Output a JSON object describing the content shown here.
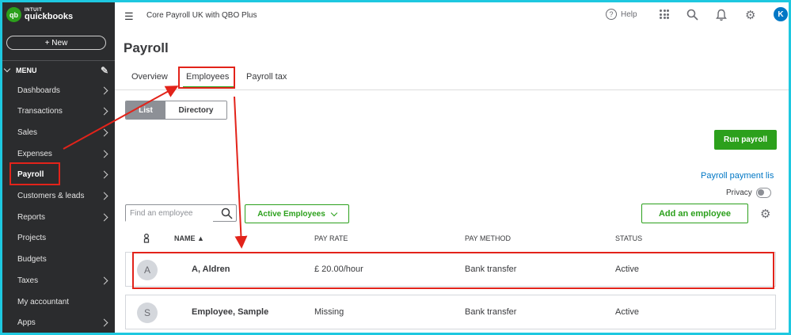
{
  "logo": {
    "brand_small": "INTUIT",
    "brand_name": "quickbooks",
    "mark": "qb"
  },
  "sidebar": {
    "new_label": "+ New",
    "menu_label": "MENU",
    "items": [
      {
        "label": "Dashboards",
        "has_arrow": true
      },
      {
        "label": "Transactions",
        "has_arrow": true
      },
      {
        "label": "Sales",
        "has_arrow": true
      },
      {
        "label": "Expenses",
        "has_arrow": true
      },
      {
        "label": "Payroll",
        "has_arrow": true,
        "active": true
      },
      {
        "label": "Customers & leads",
        "has_arrow": true
      },
      {
        "label": "Reports",
        "has_arrow": true
      },
      {
        "label": "Projects",
        "has_arrow": false
      },
      {
        "label": "Budgets",
        "has_arrow": false
      },
      {
        "label": "Taxes",
        "has_arrow": true
      },
      {
        "label": "My accountant",
        "has_arrow": false
      },
      {
        "label": "Apps",
        "has_arrow": true
      }
    ]
  },
  "topbar": {
    "company": "Core Payroll UK with QBO Plus",
    "help_label": "Help",
    "avatar_initial": "K"
  },
  "page": {
    "title": "Payroll",
    "tabs": [
      {
        "label": "Overview"
      },
      {
        "label": "Employees",
        "selected": true
      },
      {
        "label": "Payroll tax"
      }
    ],
    "view_toggle": {
      "list": "List",
      "directory": "Directory",
      "selected": "List"
    },
    "run_payroll": "Run payroll",
    "payment_link": "Payroll payment lis",
    "privacy_label": "Privacy",
    "search_placeholder": "Find an employee",
    "filter_label": "Active Employees",
    "add_employee": "Add an employee"
  },
  "table": {
    "columns": [
      "NAME ▲",
      "PAY RATE",
      "PAY METHOD",
      "STATUS"
    ],
    "rows": [
      {
        "initial": "A",
        "name": "A, Aldren",
        "pay_rate": "£ 20.00/hour",
        "pay_method": "Bank transfer",
        "status": "Active"
      },
      {
        "initial": "S",
        "name": "Employee, Sample",
        "pay_rate": "Missing",
        "pay_method": "Bank transfer",
        "status": "Active"
      }
    ]
  },
  "colors": {
    "accent_green": "#2ca01c",
    "annotation_red": "#e2231a",
    "sidebar_bg": "#2b2c2e",
    "link_blue": "#0077c5"
  }
}
